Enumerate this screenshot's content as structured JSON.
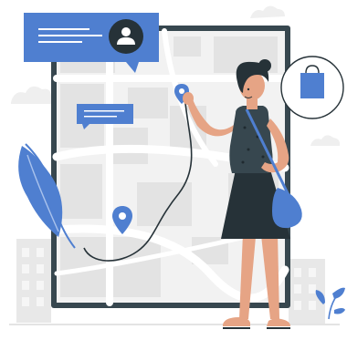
{
  "illustration": {
    "palette": {
      "accent": "#4F7FD0",
      "dark": "#263238",
      "skin": "#E6A485",
      "map_bg": "#F2F2F2",
      "map_road": "#FFFFFF",
      "map_block": "#E3E3E3",
      "frame": "#37474F",
      "building": "#E8E8E8",
      "leaf_light": "#A9C2EC"
    },
    "icons": [
      "user-icon",
      "shopping-bag-icon",
      "location-pin-icon"
    ]
  }
}
